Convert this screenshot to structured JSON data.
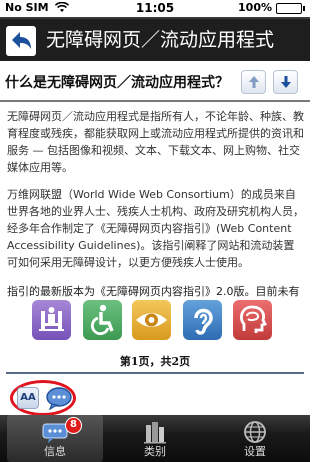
{
  "status_bar": {
    "carrier": "No SIM",
    "time": "11:05",
    "battery_percent": "100%",
    "battery_level": 1.0
  },
  "title_bar": {
    "title": "无障碍网页／流动应用程式",
    "back_icon": "back-arrow-icon"
  },
  "question_bar": {
    "question": "什么是无障碍网页／流动应用程式？",
    "up_icon": "arrow-up-icon",
    "down_icon": "arrow-down-icon"
  },
  "content": {
    "paragraph1": "无障碍网页／流动应用程式是指所有人，不论年龄、种族、教育程度或残疾，都能获取网上或流动应用程式所提供的资讯和服务 — 包括图像和视频、文本、下载文本、网上购物、社交媒体应用等。",
    "paragraph2": "万维网联盟（World Wide Web Consortium）的成员来自世界各地的业界人士、残疾人士机构、政府及研究机构人员，经多年合作制定了《无障碍网页内容指引》(Web Content Accessibility Guidelines)。该指引阐释了网站和流动装置可如何采用无障碍设计，以更方便残疾人士使用。",
    "paragraph3": "指引的最新版本为《无障碍网页内容指引》2.0版。目前未有",
    "icons": [
      "reading-person-icon",
      "wheelchair-icon",
      "eye-icon",
      "ear-icon",
      "head-brain-icon"
    ],
    "page_info": "第1页，共2页"
  },
  "tools": {
    "font_button": "AA",
    "chat_icon": "speech-bubble-icon"
  },
  "tab_bar": {
    "tabs": [
      {
        "label": "信息",
        "icon": "messages-icon",
        "badge": "8"
      },
      {
        "label": "类别",
        "icon": "books-icon"
      },
      {
        "label": "设置",
        "icon": "globe-icon"
      }
    ]
  },
  "colors": {
    "title_bar_bg": "#1e1e1e",
    "badge_red": "#e01b1b",
    "highlight_ring": "#e0141e"
  }
}
